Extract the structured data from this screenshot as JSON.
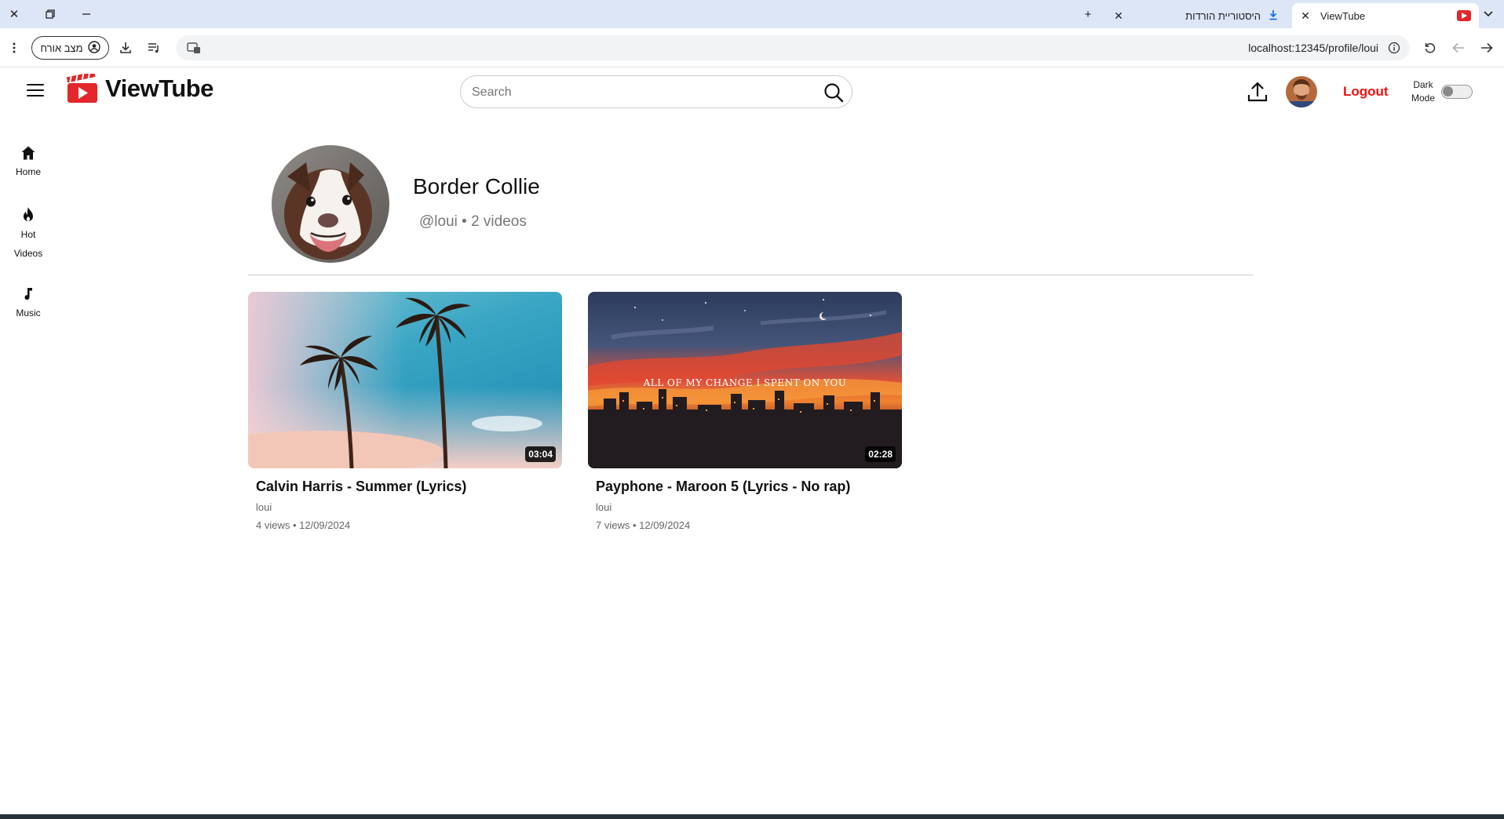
{
  "browser": {
    "tabs": [
      {
        "title": "ViewTube",
        "active": true
      },
      {
        "title": "היסטוריית הורדות",
        "active": false
      }
    ],
    "guest_label": "מצב אורח",
    "url": "localhost:12345/profile/loui"
  },
  "header": {
    "logo_text": "ViewTube",
    "search_placeholder": "Search",
    "logout_label": "Logout",
    "dark_mode_label_1": "Dark",
    "dark_mode_label_2": "Mode",
    "dark_mode_on": false,
    "brand_color": "#e3262b"
  },
  "sidebar": {
    "items": [
      {
        "label": "Home",
        "icon": "home-icon"
      },
      {
        "label_1": "Hot",
        "label_2": "Videos",
        "icon": "flame-icon"
      },
      {
        "label": "Music",
        "icon": "music-note-icon"
      }
    ]
  },
  "profile": {
    "name": "Border Collie",
    "meta": "@loui • 2 videos"
  },
  "videos": [
    {
      "title": "Calvin Harris - Summer (Lyrics)",
      "channel": "loui",
      "stats": "4 views • 12/09/2024",
      "duration": "03:04"
    },
    {
      "title": "Payphone - Maroon 5 (Lyrics - No rap)",
      "channel": "loui",
      "stats": "7 views • 12/09/2024",
      "duration": "02:28",
      "thumb_caption": "ALL OF MY CHANGE I SPENT ON YOU"
    }
  ]
}
